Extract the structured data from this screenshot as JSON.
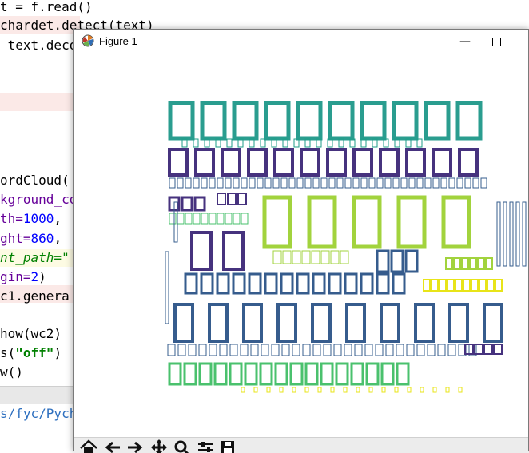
{
  "editor": {
    "lines": [
      {
        "id": "l1",
        "text": "t = f.read()"
      },
      {
        "id": "l2",
        "text": "chardet.detect(text)"
      },
      {
        "id": "l3",
        "text": " text.deco"
      },
      {
        "id": "l4",
        "text": "ordCloud("
      },
      {
        "id": "l5",
        "text": "kground_co"
      },
      {
        "id": "l6a",
        "text": "th="
      },
      {
        "id": "l6b",
        "text": "1000"
      },
      {
        "id": "l6c",
        "text": ","
      },
      {
        "id": "l7a",
        "text": "ght="
      },
      {
        "id": "l7b",
        "text": "860"
      },
      {
        "id": "l7c",
        "text": ","
      },
      {
        "id": "l8",
        "text": "nt_path=\""
      },
      {
        "id": "l9a",
        "text": "gin="
      },
      {
        "id": "l9b",
        "text": "2"
      },
      {
        "id": "l9c",
        "text": ")"
      },
      {
        "id": "l10",
        "text": "c1.genera"
      },
      {
        "id": "l11",
        "text": "how(wc2)"
      },
      {
        "id": "l12a",
        "text": "s("
      },
      {
        "id": "l12b",
        "text": "\"off\""
      },
      {
        "id": "l12c",
        "text": ")"
      },
      {
        "id": "l13",
        "text": "w()"
      }
    ],
    "path_text": "s/fyc/Pych"
  },
  "figure": {
    "title": "Figure 1",
    "minimize_label": "—",
    "icons": {
      "app": "matplotlib-icon",
      "home": "home-icon",
      "back": "back-arrow-icon",
      "forward": "forward-arrow-icon",
      "pan": "pan-move-icon",
      "zoom": "zoom-magnifier-icon",
      "configure": "configure-subplots-icon",
      "save": "save-disk-icon"
    },
    "palette": {
      "teal": "#2a9d8f",
      "purple": "#46327e",
      "lime": "#a2d33d",
      "steel": "#365c8d",
      "green": "#4ac16d",
      "yellow": "#e8e419",
      "darkgreen": "#1f9e89"
    },
    "wordcloud_rows": [
      {
        "color": "teal",
        "count": 10,
        "kind": "large"
      },
      {
        "color": "purple",
        "count": 12,
        "kind": "medium"
      },
      {
        "color": "lime",
        "count": 5,
        "kind": "large-box"
      },
      {
        "color": "purple",
        "count": 2,
        "kind": "medium-box"
      },
      {
        "color": "steel",
        "count": 10,
        "kind": "small"
      },
      {
        "color": "steel",
        "count": 10,
        "kind": "large"
      },
      {
        "color": "green",
        "count": 16,
        "kind": "small"
      }
    ]
  }
}
